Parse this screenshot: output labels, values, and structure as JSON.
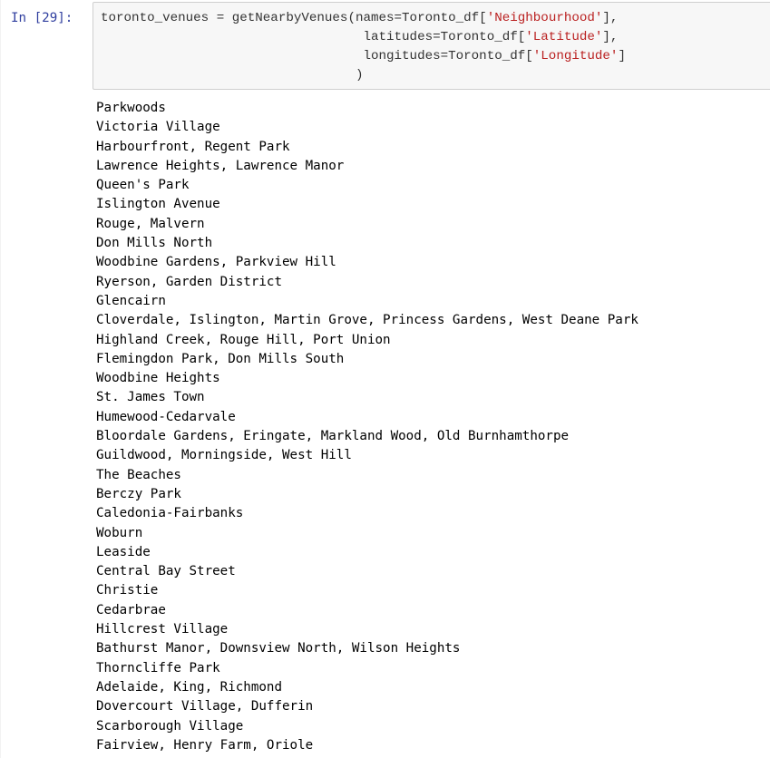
{
  "cell": {
    "prompt": "In [29]:",
    "code": {
      "line1_prefix": "toronto_venues = getNearbyVenues(names=Toronto_df[",
      "line1_string": "'Neighbourhood'",
      "line1_suffix": "],",
      "line2_prefix": "                                  latitudes=Toronto_df[",
      "line2_string": "'Latitude'",
      "line2_suffix": "],",
      "line3_prefix": "                                  longitudes=Toronto_df[",
      "line3_string": "'Longitude'",
      "line3_suffix": "]",
      "line4": "                                 )"
    }
  },
  "output": {
    "lines": [
      "Parkwoods",
      "Victoria Village",
      "Harbourfront, Regent Park",
      "Lawrence Heights, Lawrence Manor",
      "Queen's Park",
      "Islington Avenue",
      "Rouge, Malvern",
      "Don Mills North",
      "Woodbine Gardens, Parkview Hill",
      "Ryerson, Garden District",
      "Glencairn",
      "Cloverdale, Islington, Martin Grove, Princess Gardens, West Deane Park",
      "Highland Creek, Rouge Hill, Port Union",
      "Flemingdon Park, Don Mills South",
      "Woodbine Heights",
      "St. James Town",
      "Humewood-Cedarvale",
      "Bloordale Gardens, Eringate, Markland Wood, Old Burnhamthorpe",
      "Guildwood, Morningside, West Hill",
      "The Beaches",
      "Berczy Park",
      "Caledonia-Fairbanks",
      "Woburn",
      "Leaside",
      "Central Bay Street",
      "Christie",
      "Cedarbrae",
      "Hillcrest Village",
      "Bathurst Manor, Downsview North, Wilson Heights",
      "Thorncliffe Park",
      "Adelaide, King, Richmond",
      "Dovercourt Village, Dufferin",
      "Scarborough Village",
      "Fairview, Henry Farm, Oriole"
    ]
  }
}
